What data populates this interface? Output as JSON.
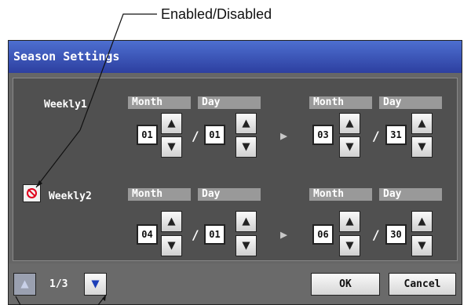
{
  "callout": {
    "text": "Enabled/Disabled"
  },
  "window": {
    "title": "Season Settings"
  },
  "column_labels": {
    "month": "Month",
    "day": "Day"
  },
  "separator": "/",
  "range_arrow": "▶",
  "weekly1": {
    "label": "Weekly1",
    "start": {
      "month": "01",
      "day": "01"
    },
    "end": {
      "month": "03",
      "day": "31"
    }
  },
  "weekly2": {
    "label": "Weekly2",
    "enabled_toggle": "disabled",
    "start": {
      "month": "04",
      "day": "01"
    },
    "end": {
      "month": "06",
      "day": "30"
    }
  },
  "pagination": {
    "indicator": "1/3"
  },
  "buttons": {
    "ok": "OK",
    "cancel": "Cancel"
  },
  "icons": {
    "up": "▲",
    "down": "▼"
  },
  "colors": {
    "title_bar": "#3450b8",
    "accent_blue": "#1d3fb8",
    "disabled_icon": "#e0001c"
  }
}
